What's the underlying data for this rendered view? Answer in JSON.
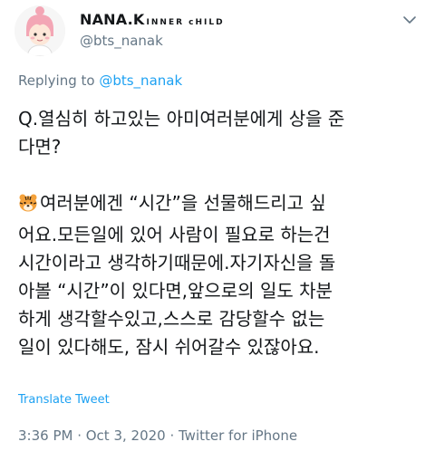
{
  "author": {
    "display_name": "NANA.K",
    "name_suffix": "INNER cHILD",
    "handle": "@bts_nanak",
    "avatar": "cartoon-avatar"
  },
  "reply": {
    "prefix": "Replying to ",
    "mention": "@bts_nanak"
  },
  "tweet": {
    "question_line1": "Q.열심히 하고있는 아미여러분에게 상을 준",
    "question_line2": "다면?",
    "answer_emoji": "tiger-face-icon",
    "answer_line1": "여러분에겐 “시간”을 선물해드리고 싶",
    "answer_line2": "어요.모든일에 있어 사람이 필요로 하는건",
    "answer_line3": "시간이라고 생각하기때문에.자기자신을 돌",
    "answer_line4": "아볼 “시간”이 있다면,앞으로의 일도 차분",
    "answer_line5": "하게 생각할수있고,스스로 감당할수 없는",
    "answer_line6": "일이 있다해도, 잠시 쉬어갈수 있잖아요."
  },
  "translate_label": "Translate Tweet",
  "meta": {
    "timestamp": "3:36 PM · Oct 3, 2020 · Twitter for iPhone"
  },
  "colors": {
    "link": "#1da1f2",
    "muted": "#657786",
    "text": "#14171a"
  }
}
